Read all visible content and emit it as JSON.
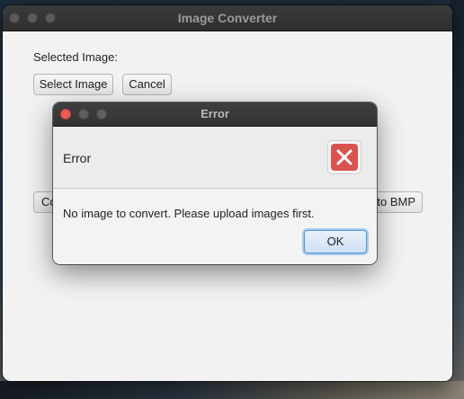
{
  "main_window": {
    "title": "Image Converter",
    "selected_label": "Selected Image:",
    "select_button": "Select Image",
    "cancel_button": "Cancel",
    "convert_left_partial": "Co",
    "convert_bmp_partial": "to BMP"
  },
  "dialog": {
    "title": "Error",
    "header": "Error",
    "message": "No image to convert. Please upload images first.",
    "ok_button": "OK",
    "icon": "error-x-icon",
    "icon_color": "#d9534f"
  }
}
